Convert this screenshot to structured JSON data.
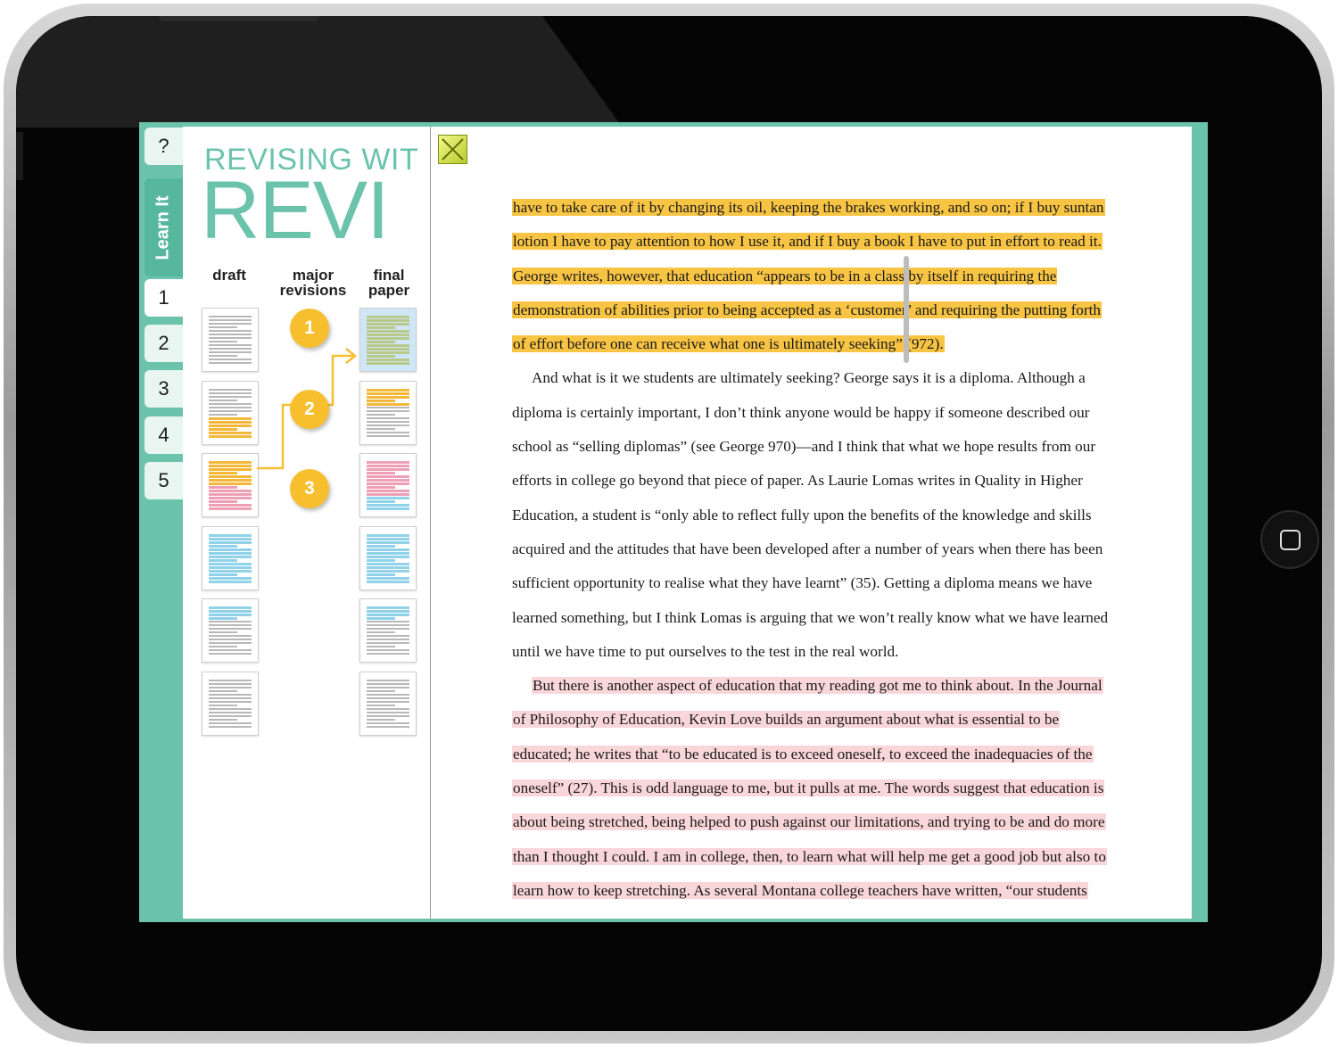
{
  "colors": {
    "teal": "#6cc3ac",
    "yellow_highlight": "#f8c444",
    "pink_highlight": "#f9d6d9",
    "badge": "#f7bf2e"
  },
  "sidebar": {
    "help_label": "?",
    "learn_label": "Learn It",
    "tabs": [
      "1",
      "2",
      "3",
      "4",
      "5"
    ],
    "active_tab": "1"
  },
  "lesson": {
    "subtitle_visible": "REVISING WIT",
    "title_visible": "REVI",
    "columns": [
      "draft",
      "major\nrevisions",
      "final\npaper"
    ],
    "steps": [
      "1",
      "2",
      "3"
    ]
  },
  "document": {
    "close_icon": "close-icon",
    "paragraphs": [
      {
        "highlight": "yellow",
        "lines": [
          "have to take care of it by changing its oil, keeping the brakes working, and so on; if I buy suntan",
          "lotion I have to pay attention to how I use it, and if I buy a book I have to put in effort to read it.",
          "George writes, however, that education “appears to be in a class by itself in requiring the",
          "demonstration of abilities prior to being accepted as a ‘customer’ and requiring the putting forth",
          "of effort before one can receive what one is ultimately seeking” (972)."
        ]
      },
      {
        "highlight": "none",
        "lines": [
          "And what is it we students are ultimately seeking? George says it is a diploma. Although a",
          "diploma is certainly important, I don’t think anyone would be happy if someone described our",
          "school as “selling diplomas” (see George 970)—and I think that what we hope results from our",
          "efforts in college go beyond that piece of paper. As Laurie Lomas writes in Quality in Higher",
          "Education, a student is “only able to reflect fully upon the benefits of the knowledge and skills",
          "acquired and the attitudes that have been developed after a number of years when there has been",
          "sufficient opportunity to realise what they have learnt” (35). Getting a diploma means we have",
          "learned something, but I think Lomas is arguing that we won’t really know what we have learned",
          "until we have time to put ourselves to the test in the real world."
        ]
      },
      {
        "highlight": "pink",
        "lines": [
          "But there is another aspect of education that my reading got me to think about. In the Journal",
          "of Philosophy of Education, Kevin Love builds an argument about what is essential to be",
          "educated; he writes that “to be educated is to exceed oneself, to exceed the inadequacies of the",
          "oneself” (27). This is odd language to me, but it pulls at me. The words suggest that education is",
          "about being stretched, being helped to push against our limitations, and trying to be and do more",
          "than I thought I could. I am in college, then, to learn what will help me get a good job but also to",
          "learn how to keep stretching. As several Montana college teachers have written, “our students"
        ]
      }
    ]
  }
}
